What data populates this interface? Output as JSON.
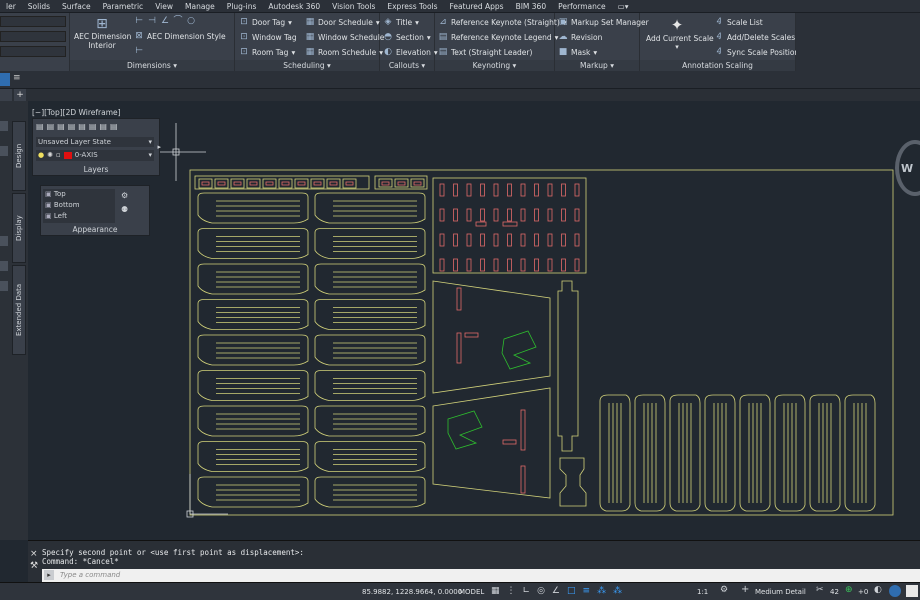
{
  "menu": [
    "ler",
    "Solids",
    "Surface",
    "Parametric",
    "View",
    "Manage",
    "Plug-ins",
    "Autodesk 360",
    "Vision Tools",
    "Express Tools",
    "Featured Apps",
    "BIM 360",
    "Performance"
  ],
  "ribbon": {
    "dimensions": {
      "title": "Dimensions",
      "aec_dim_label": "AEC Dimension",
      "aec_dim_sub": "Interior",
      "aec_dim_style": "AEC Dimension Style"
    },
    "scheduling": {
      "title": "Scheduling",
      "door_tag": "Door Tag",
      "window_tag": "Window Tag",
      "room_tag": "Room Tag",
      "door_schedule": "Door Schedule",
      "window_schedule": "Window Schedule",
      "room_schedule": "Room Schedule"
    },
    "callouts": {
      "title": "Callouts",
      "items": [
        "Title",
        "Section",
        "Elevation"
      ]
    },
    "keynoting": {
      "title": "Keynoting",
      "items": [
        "Reference Keynote (Straight)",
        "Reference Keynote Legend",
        "Text (Straight Leader)"
      ]
    },
    "markup": {
      "title": "Markup",
      "items": [
        "Markup Set Manager",
        "Revision",
        "Mask"
      ]
    },
    "annotation": {
      "title": "Annotation Scaling",
      "add_scale": "Add Current Scale",
      "items": [
        "Scale List",
        "Add/Delete Scales",
        "Sync Scale Positions"
      ]
    }
  },
  "view_label": "[−][Top][2D Wireframe]",
  "layers": {
    "title": "Layers",
    "state": "Unsaved Layer State",
    "current": "0-AXIS",
    "current_color": "#e01010"
  },
  "appearance": {
    "title": "Appearance",
    "views": [
      "Top",
      "Bottom",
      "Left"
    ]
  },
  "side_tabs": [
    "Design",
    "Display",
    "Extended Data"
  ],
  "compass_letter": "W",
  "command": {
    "line1": "Specify second point or <use first point as displacement>:",
    "line2": "Command: *Cancel*",
    "placeholder": "Type a command"
  },
  "status": {
    "coords": "85.9882, 1228.9664, 0.0000",
    "model": "MODEL",
    "scale": "1:1",
    "detail": "Medium Detail",
    "number": "42",
    "plus": "+0"
  },
  "colors": {
    "background": "#212830",
    "outline": "#d2d27a",
    "red": "#e06a6a",
    "green": "#2ec02e"
  }
}
